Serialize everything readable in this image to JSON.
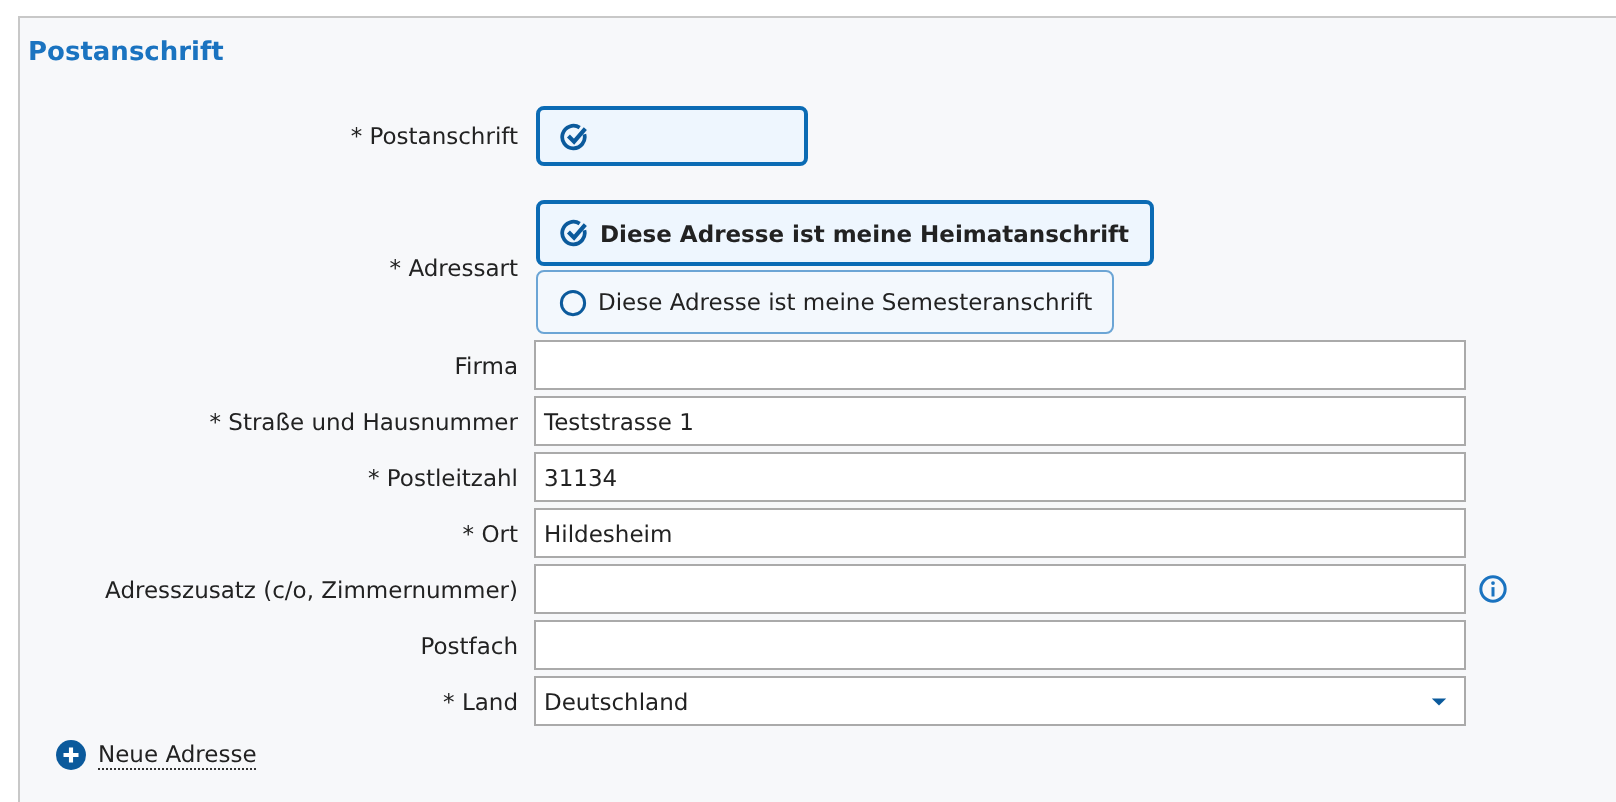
{
  "section_title": "Postanschrift",
  "postanschrift": {
    "label": "* Postanschrift",
    "checked": true
  },
  "adressart": {
    "label": "* Adressart",
    "options": [
      {
        "label": "Diese Adresse ist meine Heimatanschrift",
        "selected": true
      },
      {
        "label": "Diese Adresse ist meine Semesteranschrift",
        "selected": false
      }
    ]
  },
  "fields": [
    {
      "label": "Firma",
      "kind": "text",
      "info": false
    },
    {
      "label": "* Straße und Hausnummer",
      "kind": "text",
      "value": "Teststrasse 1",
      "info": false
    },
    {
      "label": "* Postleitzahl",
      "kind": "text",
      "value": "31134",
      "info": false
    },
    {
      "label": "* Ort",
      "kind": "text",
      "value": "Hildesheim",
      "info": false
    },
    {
      "label": "Adresszusatz (c/o, Zimmernummer)",
      "kind": "text",
      "info": true
    },
    {
      "label": "Postfach",
      "kind": "text",
      "info": false
    },
    {
      "label": "* Land",
      "kind": "select",
      "value": "Deutschland",
      "info": false
    }
  ],
  "add_link": "Neue Adresse"
}
